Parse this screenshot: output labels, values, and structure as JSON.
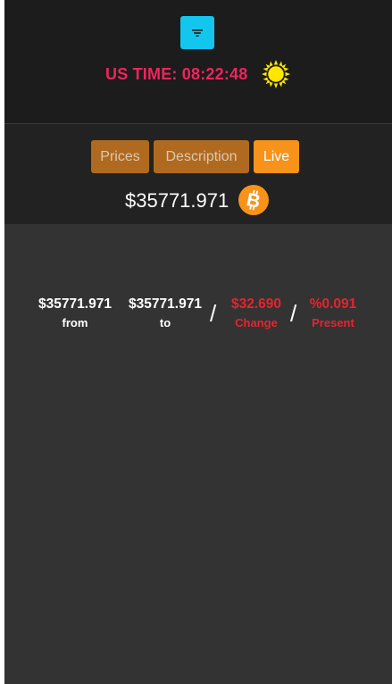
{
  "header": {
    "filter_icon": "filter-icon",
    "time_text": "US TIME: 08:22:48",
    "theme_icon": "sun-icon"
  },
  "tabs": [
    {
      "label": "Prices"
    },
    {
      "label": "Description"
    },
    {
      "label": "Live"
    }
  ],
  "price": {
    "value": "$35771.971",
    "coin_icon": "bitcoin-icon"
  },
  "stats": {
    "from_value": "$35771.971",
    "from_label": "from",
    "to_value": "$35771.971",
    "to_label": "to",
    "change_value": "$32.690",
    "change_label": "Change",
    "present_value": "%0.091",
    "present_label": "Present",
    "separator": "/"
  },
  "colors": {
    "accent_cyan": "#13c6ee",
    "time_pink": "#f0245d",
    "sun_yellow": "#ffe600",
    "bitcoin_orange": "#f7931a",
    "negative_red": "#e8232e",
    "tab_dim": "#b06a20"
  }
}
